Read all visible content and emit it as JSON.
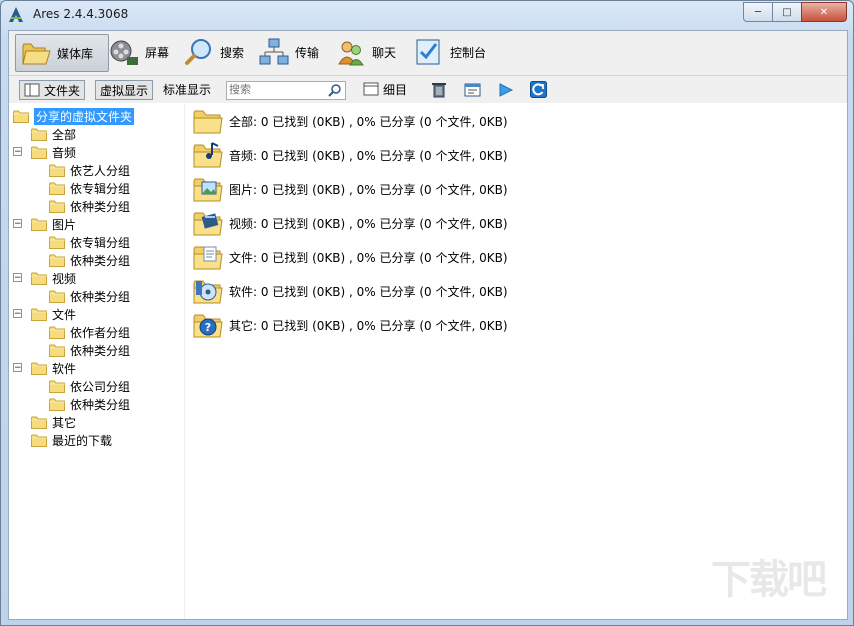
{
  "window": {
    "title": "Ares 2.4.4.3068",
    "minimize": "─",
    "maximize": "□",
    "close": "✕"
  },
  "toolbar": [
    {
      "label": "媒体库",
      "icon": "library-folder-icon"
    },
    {
      "label": "屏幕",
      "icon": "film-reel-icon"
    },
    {
      "label": "搜索",
      "icon": "magnifier-icon"
    },
    {
      "label": "传输",
      "icon": "network-transfer-icon"
    },
    {
      "label": "聊天",
      "icon": "chat-users-icon"
    },
    {
      "label": "控制台",
      "icon": "control-panel-icon"
    }
  ],
  "subtoolbar": {
    "folder_btn": "文件夹",
    "virtual_btn": "虚拟显示",
    "standard_btn": "标准显示",
    "search_placeholder": "搜索",
    "details_btn": "细目"
  },
  "tree": {
    "root": "分享的虚拟文件夹",
    "items": [
      {
        "label": "全部"
      },
      {
        "label": "音频"
      },
      {
        "label": "依艺人分组"
      },
      {
        "label": "依专辑分组"
      },
      {
        "label": "依种类分组"
      },
      {
        "label": "图片"
      },
      {
        "label": "依专辑分组"
      },
      {
        "label": "依种类分组"
      },
      {
        "label": "视频"
      },
      {
        "label": "依种类分组"
      },
      {
        "label": "文件"
      },
      {
        "label": "依作者分组"
      },
      {
        "label": "依种类分组"
      },
      {
        "label": "软件"
      },
      {
        "label": "依公司分组"
      },
      {
        "label": "依种类分组"
      },
      {
        "label": "其它"
      },
      {
        "label": "最近的下载"
      }
    ]
  },
  "list": [
    {
      "text": "全部: 0 已找到 (0KB) , 0% 已分享 (0 个文件, 0KB)",
      "icon": "open-folder-icon"
    },
    {
      "text": "音频: 0 已找到 (0KB) , 0% 已分享 (0 个文件, 0KB)",
      "icon": "music-folder-icon"
    },
    {
      "text": "图片: 0 已找到 (0KB) , 0% 已分享 (0 个文件, 0KB)",
      "icon": "picture-folder-icon"
    },
    {
      "text": "视频: 0 已找到 (0KB) , 0% 已分享 (0 个文件, 0KB)",
      "icon": "video-folder-icon"
    },
    {
      "text": "文件: 0 已找到 (0KB) , 0% 已分享 (0 个文件, 0KB)",
      "icon": "document-folder-icon"
    },
    {
      "text": "软件: 0 已找到 (0KB) , 0% 已分享 (0 个文件, 0KB)",
      "icon": "software-folder-icon"
    },
    {
      "text": "其它: 0 已找到 (0KB) , 0% 已分享 (0 个文件, 0KB)",
      "icon": "help-folder-icon"
    }
  ],
  "colors": {
    "selection": "#3399ff",
    "folder": "#f3d36b",
    "accent_blue": "#2a7fd4"
  }
}
